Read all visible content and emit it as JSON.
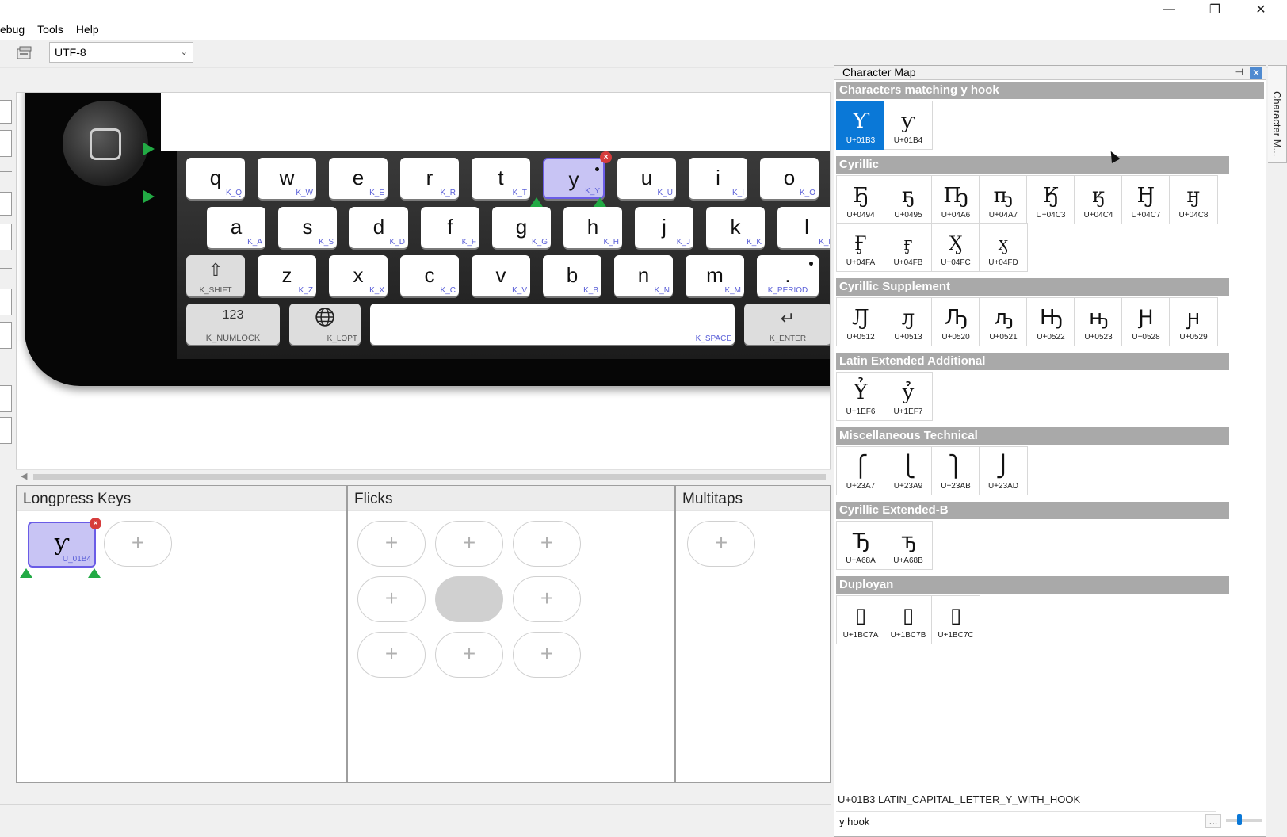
{
  "window": {
    "minimize_glyph": "—",
    "maximize_glyph": "❐",
    "close_glyph": "✕"
  },
  "menu": {
    "items": [
      "ebug",
      "Tools",
      "Help"
    ]
  },
  "toolbar": {
    "encoding_value": "UTF-8",
    "encoding_arrow": "⌄"
  },
  "keyboard": {
    "rows": [
      [
        {
          "label": "q",
          "code": "K_Q"
        },
        {
          "label": "w",
          "code": "K_W"
        },
        {
          "label": "e",
          "code": "K_E"
        },
        {
          "label": "r",
          "code": "K_R"
        },
        {
          "label": "t",
          "code": "K_T"
        },
        {
          "label": "y",
          "code": "K_Y",
          "selected": true
        },
        {
          "label": "u",
          "code": "K_U"
        },
        {
          "label": "i",
          "code": "K_I"
        },
        {
          "label": "o",
          "code": "K_O"
        }
      ],
      [
        {
          "label": "a",
          "code": "K_A"
        },
        {
          "label": "s",
          "code": "K_S"
        },
        {
          "label": "d",
          "code": "K_D"
        },
        {
          "label": "f",
          "code": "K_F"
        },
        {
          "label": "g",
          "code": "K_G"
        },
        {
          "label": "h",
          "code": "K_H"
        },
        {
          "label": "j",
          "code": "K_J"
        },
        {
          "label": "k",
          "code": "K_K"
        },
        {
          "label": "l",
          "code": "K_L"
        }
      ],
      [
        {
          "label": "z",
          "code": "K_Z"
        },
        {
          "label": "x",
          "code": "K_X"
        },
        {
          "label": "c",
          "code": "K_C"
        },
        {
          "label": "v",
          "code": "K_V"
        },
        {
          "label": "b",
          "code": "K_B"
        },
        {
          "label": "n",
          "code": "K_N"
        },
        {
          "label": "m",
          "code": "K_M"
        },
        {
          "label": ".",
          "code": "K_PERIOD"
        }
      ]
    ],
    "shift": {
      "label": "⇧",
      "code": "K_SHIFT"
    },
    "numlock": {
      "label": "123",
      "code": "K_NUMLOCK"
    },
    "lopt": {
      "label": "🌐",
      "code": "K_LOPT"
    },
    "space": {
      "label": "",
      "code": "K_SPACE"
    },
    "enter": {
      "label": "↵",
      "code": "K_ENTER"
    }
  },
  "panels": {
    "longpress": {
      "title": "Longpress Keys",
      "key_label": "ƴ",
      "key_code": "U_01B4",
      "add": "+"
    },
    "flicks": {
      "title": "Flicks",
      "add": "+"
    },
    "multitaps": {
      "title": "Multitaps",
      "add": "+"
    }
  },
  "charmap": {
    "title": "Character Map",
    "pin_glyph": "⊣",
    "close_glyph": "✕",
    "side_tab": "Character M...",
    "groups": [
      {
        "name": "Characters matching y hook",
        "chars": [
          {
            "glyph": "Ƴ",
            "code": "U+01B3",
            "active": true
          },
          {
            "glyph": "ƴ",
            "code": "U+01B4"
          }
        ]
      },
      {
        "name": "Cyrillic",
        "chars": [
          {
            "glyph": "Ҕ",
            "code": "U+0494"
          },
          {
            "glyph": "ҕ",
            "code": "U+0495"
          },
          {
            "glyph": "Ҧ",
            "code": "U+04A6"
          },
          {
            "glyph": "ҧ",
            "code": "U+04A7"
          },
          {
            "glyph": "Ӄ",
            "code": "U+04C3"
          },
          {
            "glyph": "ӄ",
            "code": "U+04C4"
          },
          {
            "glyph": "Ӈ",
            "code": "U+04C7"
          },
          {
            "glyph": "ӈ",
            "code": "U+04C8"
          },
          {
            "glyph": "Ӻ",
            "code": "U+04FA"
          },
          {
            "glyph": "ӻ",
            "code": "U+04FB"
          },
          {
            "glyph": "Ӽ",
            "code": "U+04FC"
          },
          {
            "glyph": "ӽ",
            "code": "U+04FD"
          }
        ]
      },
      {
        "name": "Cyrillic Supplement",
        "chars": [
          {
            "glyph": "Ԓ",
            "code": "U+0512"
          },
          {
            "glyph": "ԓ",
            "code": "U+0513"
          },
          {
            "glyph": "Ԡ",
            "code": "U+0520"
          },
          {
            "glyph": "ԡ",
            "code": "U+0521"
          },
          {
            "glyph": "Ԣ",
            "code": "U+0522"
          },
          {
            "glyph": "ԣ",
            "code": "U+0523"
          },
          {
            "glyph": "Ԩ",
            "code": "U+0528"
          },
          {
            "glyph": "ԩ",
            "code": "U+0529"
          }
        ]
      },
      {
        "name": "Latin Extended Additional",
        "chars": [
          {
            "glyph": "Ỷ",
            "code": "U+1EF6"
          },
          {
            "glyph": "ỷ",
            "code": "U+1EF7"
          }
        ]
      },
      {
        "name": "Miscellaneous Technical",
        "chars": [
          {
            "glyph": "⎧",
            "code": "U+23A7"
          },
          {
            "glyph": "⎩",
            "code": "U+23A9"
          },
          {
            "glyph": "⎫",
            "code": "U+23AB"
          },
          {
            "glyph": "⎭",
            "code": "U+23AD"
          }
        ]
      },
      {
        "name": "Cyrillic Extended-B",
        "chars": [
          {
            "glyph": "Ꚋ",
            "code": "U+A68A"
          },
          {
            "glyph": "ꚋ",
            "code": "U+A68B"
          }
        ]
      },
      {
        "name": "Duployan",
        "chars": [
          {
            "glyph": "▯",
            "code": "U+1BC7A"
          },
          {
            "glyph": "▯",
            "code": "U+1BC7B"
          },
          {
            "glyph": "▯",
            "code": "U+1BC7C"
          }
        ]
      }
    ],
    "status": "U+01B3 LATIN_CAPITAL_LETTER_Y_WITH_HOOK",
    "filter_value": "y hook",
    "more_button": "..."
  }
}
